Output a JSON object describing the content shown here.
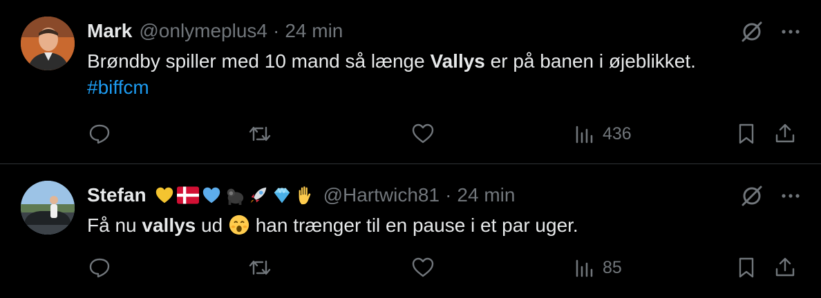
{
  "tweets": [
    {
      "name": "Mark",
      "handle": "@onlymeplus4",
      "separator": "·",
      "time": "24 min",
      "text_before": "Brøndby spiller med 10 mand så længe ",
      "text_bold": "Vallys",
      "text_after": " er på banen i øjeblikket.",
      "hashtag": "#biffcm",
      "views": "436",
      "emojis": []
    },
    {
      "name": "Stefan",
      "handle": "@Hartwich81",
      "separator": "·",
      "time": "24 min",
      "text_before": "Få nu ",
      "text_bold": "vallys",
      "text_after": " ud ",
      "text_after2": " han trænger til en pause i et par uger.",
      "views": "85",
      "emojis": [
        "yellow-heart",
        "denmark-flag",
        "blue-heart",
        "gorilla",
        "rocket",
        "gem",
        "raised-hand"
      ]
    }
  ],
  "colors": {
    "background": "#000000",
    "text": "#e7e9ea",
    "muted": "#71767b",
    "link": "#1d9bf0",
    "divider": "#2f3336"
  }
}
